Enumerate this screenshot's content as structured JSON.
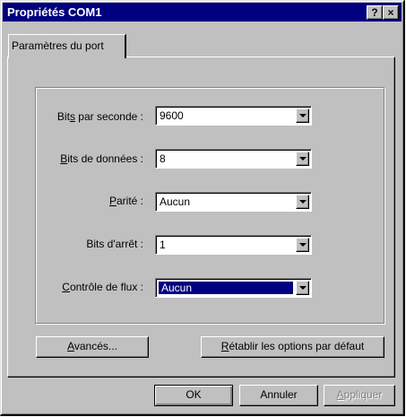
{
  "window": {
    "title": "Propriétés COM1",
    "help_glyph": "?",
    "close_glyph": "×"
  },
  "tabs": [
    {
      "label": "Paramètres du port"
    }
  ],
  "fields": {
    "bits_par_seconde": {
      "label_pre": "Bit",
      "label_key": "s",
      "label_post": " par seconde :",
      "value": "9600"
    },
    "bits_de_donnees": {
      "label_pre": "",
      "label_key": "B",
      "label_post": "its de données :",
      "value": "8"
    },
    "parite": {
      "label_pre": "",
      "label_key": "P",
      "label_post": "arité :",
      "value": "Aucun"
    },
    "bits_d_arret": {
      "label_pre": "Bits d'arrêt",
      "label_key": "",
      "label_post": " :",
      "value": "1"
    },
    "controle_de_flux": {
      "label_pre": "",
      "label_key": "C",
      "label_post": "ontrôle de flux :",
      "value": "Aucun"
    }
  },
  "buttons": {
    "avances": {
      "key": "A",
      "rest": "vancés..."
    },
    "retablir": {
      "key": "R",
      "rest": "établir les options par défaut"
    },
    "ok": "OK",
    "annuler": "Annuler",
    "appliquer": {
      "key": "A",
      "rest": "ppliquer"
    }
  }
}
